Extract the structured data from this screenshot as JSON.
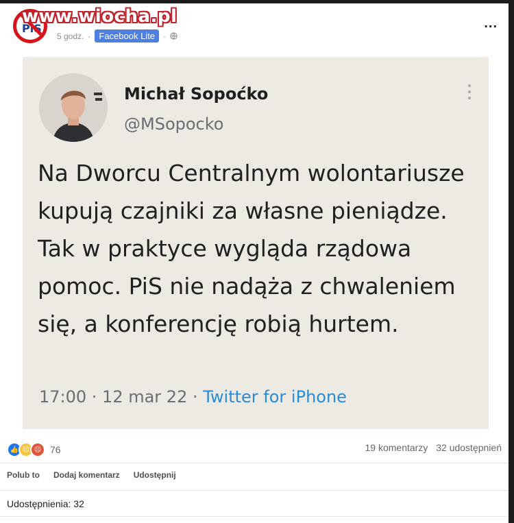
{
  "watermark": "www.wiocha.pl",
  "post": {
    "page_avatar_text": "PiS",
    "time": "5 godz.",
    "app_badge": "Facebook Lite",
    "more": "..."
  },
  "tweet": {
    "author_name": "Michał Sopoćko",
    "handle": "@MSopocko",
    "text": "Na Dworcu Centralnym wolontariusze kupują czajniki za własne pieniądze. Tak w praktyce wygląda rządowa pomoc. PiS nie nadąża z chwaleniem się, a konferencję robią hurtem.",
    "time_date": "17:00 · 12 mar 22 · ",
    "source": "Twitter for iPhone"
  },
  "stats": {
    "reactions_count": "76",
    "comments": "19 komentarzy",
    "shares": "32 udostępnień",
    "reaction_types": [
      "like",
      "sad",
      "angry"
    ]
  },
  "actions": {
    "like": "Polub to",
    "comment": "Dodaj komentarz",
    "share": "Udostępnij"
  },
  "shares_line": "Udostępnienia: 32",
  "colors": {
    "accent": "#4d7fe0",
    "link": "#2a8bd6",
    "tweet_bg": "#ede9e3"
  }
}
